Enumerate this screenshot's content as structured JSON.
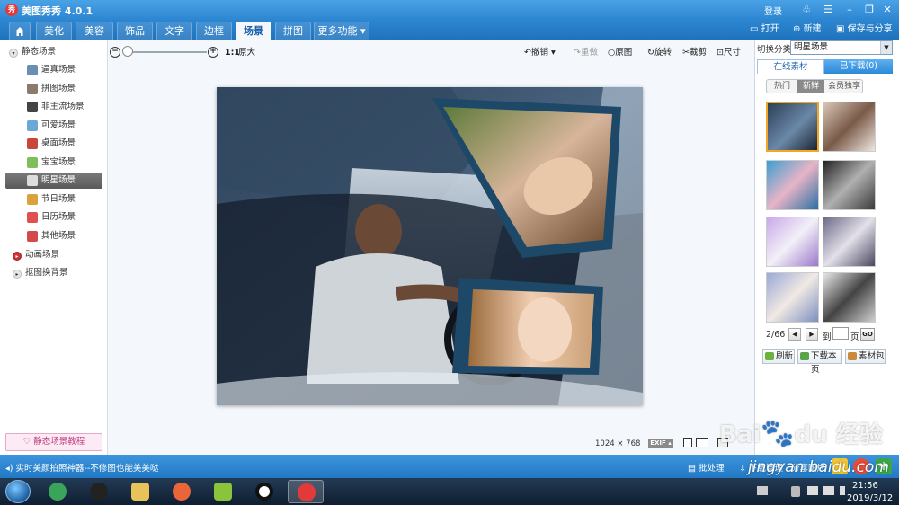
{
  "app": {
    "title": "美图秀秀 4.0.1",
    "logo": "秀"
  },
  "window": {
    "login": "登录"
  },
  "tabs": [
    "美化",
    "美容",
    "饰品",
    "文字",
    "边框",
    "场景",
    "拼图",
    "更多功能 ▾"
  ],
  "active_tab": "场景",
  "toolbar_right": {
    "open": "打开",
    "new": "新建",
    "save_share": "保存与分享"
  },
  "left_tree": {
    "static_group": "静态场景",
    "items": [
      "逼真场景",
      "拼图场景",
      "非主流场景",
      "可爱场景",
      "桌面场景",
      "宝宝场景",
      "明星场景",
      "节日场景",
      "日历场景",
      "其他场景"
    ],
    "active_item": "明星场景",
    "animated_group": "动画场景",
    "cutout_group": "抠图换背景",
    "tutorial_button": "静态场景教程"
  },
  "canvas_toolbar": {
    "zoom_ratio": "1:1",
    "original_size": "原大",
    "undo": "撤销",
    "redo": "重做",
    "original": "原图",
    "rotate": "旋转",
    "crop": "裁剪",
    "resize": "尺寸"
  },
  "canvas": {
    "width_value": "1024",
    "times": "×",
    "height_value": "768",
    "exif": "EXIF ▴"
  },
  "right_panel": {
    "category_label": "切换分类",
    "category_value": "明星场景",
    "tab_online": "在线素材",
    "tab_downloaded": "已下载(0)",
    "subtabs": [
      "热门",
      "新鲜",
      "会员独享"
    ],
    "active_subtab": "新鲜",
    "pager": {
      "current": "2/66",
      "to": "到",
      "page": "页",
      "go": "GO"
    },
    "buttons": {
      "refresh": "刷新",
      "download_page": "下载本页",
      "library": "素材包"
    }
  },
  "status_bar": {
    "promo": "实时美颜拍照神器--不修图也能美美哒",
    "batch": "批处理",
    "download_mgr": "下载管理",
    "share_photo": "分享图片"
  },
  "taskbar": {
    "time": "21:56",
    "date": "2019/3/12"
  },
  "watermark": {
    "brand": "Bai du 经验",
    "url": "jingyan.baidu.com"
  },
  "colors": {
    "title_blue": "#2d86d1",
    "status_blue": "#2278c4",
    "active_tree": "#6a6a6a",
    "selected_thumb": "#f5a623"
  }
}
